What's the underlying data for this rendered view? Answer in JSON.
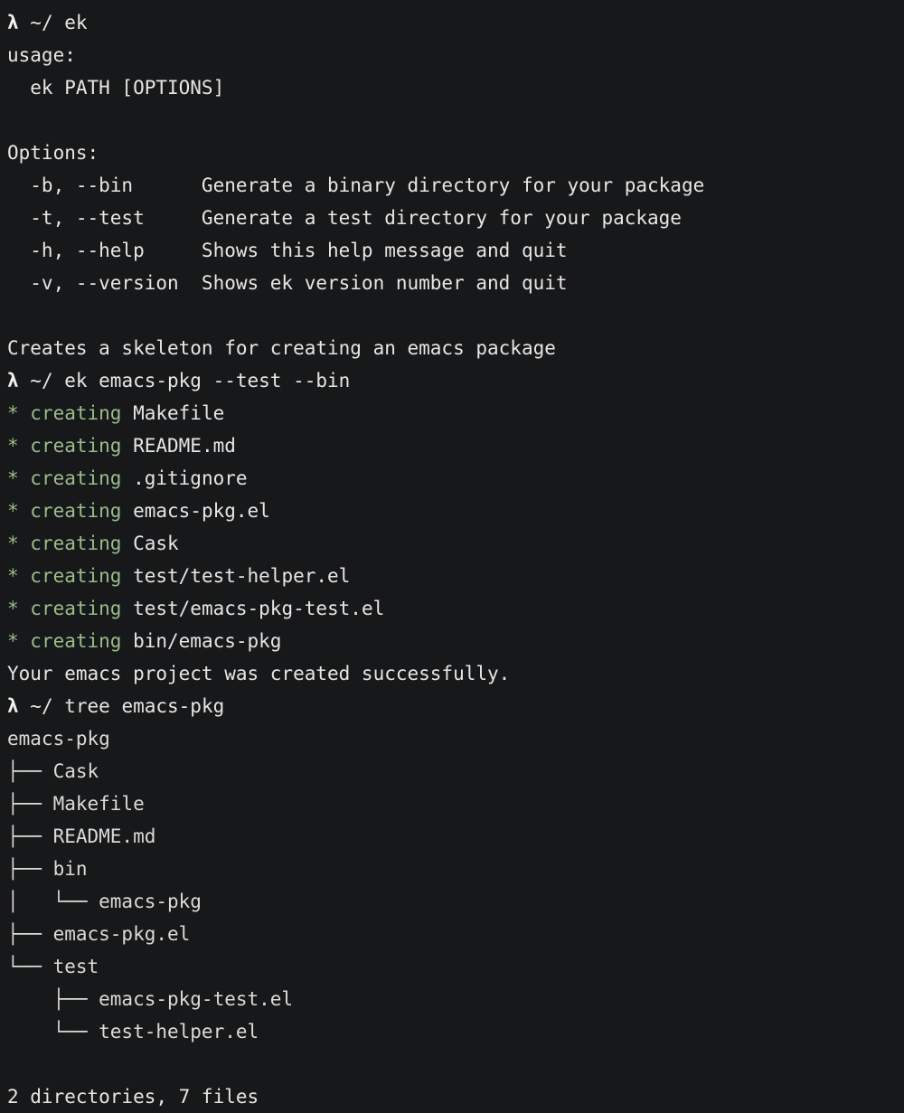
{
  "terminal": {
    "background_color": "#17181a",
    "foreground_color": "#e8e6e3",
    "accent_green": "#9dbb8a",
    "prompt_symbol": "λ",
    "prompt_path": "~/",
    "lines": [
      {
        "kind": "prompt",
        "command": "ek"
      },
      {
        "kind": "output",
        "text": "usage:"
      },
      {
        "kind": "output",
        "text": "  ek PATH [OPTIONS]"
      },
      {
        "kind": "blank",
        "text": ""
      },
      {
        "kind": "output",
        "text": "Options:"
      },
      {
        "kind": "output",
        "text": "  -b, --bin      Generate a binary directory for your package"
      },
      {
        "kind": "output",
        "text": "  -t, --test     Generate a test directory for your package"
      },
      {
        "kind": "output",
        "text": "  -h, --help     Shows this help message and quit"
      },
      {
        "kind": "output",
        "text": "  -v, --version  Shows ek version number and quit"
      },
      {
        "kind": "blank",
        "text": ""
      },
      {
        "kind": "output",
        "text": "Creates a skeleton for creating an emacs package"
      },
      {
        "kind": "prompt",
        "command": "ek emacs-pkg --test --bin"
      },
      {
        "kind": "creating",
        "marker": "*",
        "verb": "creating",
        "target": "Makefile"
      },
      {
        "kind": "creating",
        "marker": "*",
        "verb": "creating",
        "target": "README.md"
      },
      {
        "kind": "creating",
        "marker": "*",
        "verb": "creating",
        "target": ".gitignore"
      },
      {
        "kind": "creating",
        "marker": "*",
        "verb": "creating",
        "target": "emacs-pkg.el"
      },
      {
        "kind": "creating",
        "marker": "*",
        "verb": "creating",
        "target": "Cask"
      },
      {
        "kind": "creating",
        "marker": "*",
        "verb": "creating",
        "target": "test/test-helper.el"
      },
      {
        "kind": "creating",
        "marker": "*",
        "verb": "creating",
        "target": "test/emacs-pkg-test.el"
      },
      {
        "kind": "creating",
        "marker": "*",
        "verb": "creating",
        "target": "bin/emacs-pkg"
      },
      {
        "kind": "output",
        "text": "Your emacs project was created successfully."
      },
      {
        "kind": "prompt",
        "command": "tree emacs-pkg"
      },
      {
        "kind": "tree",
        "text": "emacs-pkg"
      },
      {
        "kind": "tree",
        "text": "├── Cask"
      },
      {
        "kind": "tree",
        "text": "├── Makefile"
      },
      {
        "kind": "tree",
        "text": "├── README.md"
      },
      {
        "kind": "tree",
        "text": "├── bin"
      },
      {
        "kind": "tree",
        "text": "│   └── emacs-pkg"
      },
      {
        "kind": "tree",
        "text": "├── emacs-pkg.el"
      },
      {
        "kind": "tree",
        "text": "└── test"
      },
      {
        "kind": "tree",
        "text": "    ├── emacs-pkg-test.el"
      },
      {
        "kind": "tree",
        "text": "    └── test-helper.el"
      },
      {
        "kind": "blank",
        "text": ""
      },
      {
        "kind": "output",
        "text": "2 directories, 7 files"
      }
    ]
  }
}
